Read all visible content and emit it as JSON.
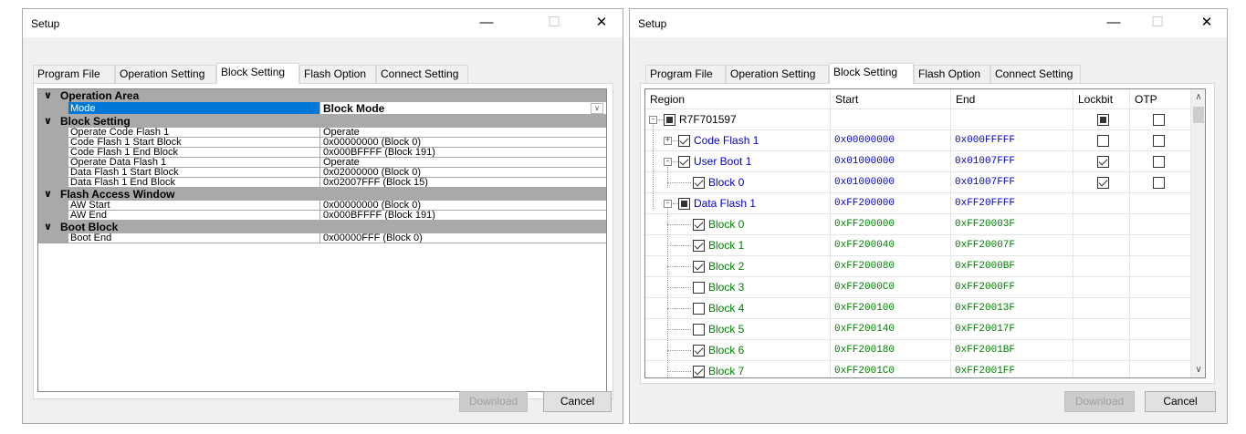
{
  "left_window": {
    "title": "Setup",
    "tabs": [
      "Program File",
      "Operation Setting",
      "Block Setting",
      "Flash Option",
      "Connect Setting"
    ],
    "active_tab": "Block Setting",
    "categories": {
      "operation_area": "Operation Area",
      "block_setting": "Block Setting",
      "flash_access_window": "Flash Access Window",
      "boot_block": "Boot Block"
    },
    "rows": {
      "mode": {
        "name": "Mode",
        "value": "Block Mode"
      },
      "operate_code_flash": {
        "name": "Operate Code Flash 1",
        "value": "Operate"
      },
      "code_flash_start": {
        "name": "Code Flash 1 Start Block",
        "value": "0x00000000 (Block 0)"
      },
      "code_flash_end": {
        "name": "Code Flash 1 End Block",
        "value": "0x000BFFFF (Block 191)"
      },
      "operate_data_flash": {
        "name": "Operate Data Flash 1",
        "value": "Operate"
      },
      "data_flash_start": {
        "name": "Data Flash 1 Start Block",
        "value": "0x02000000 (Block 0)"
      },
      "data_flash_end": {
        "name": "Data Flash 1 End Block",
        "value": "0x02007FFF (Block 15)"
      },
      "aw_start": {
        "name": "AW Start",
        "value": "0x00000000 (Block 0)"
      },
      "aw_end": {
        "name": "AW End",
        "value": "0x000BFFFF (Block 191)"
      },
      "boot_end": {
        "name": "Boot End",
        "value": "0x00000FFF (Block 0)"
      }
    },
    "buttons": {
      "download": "Download",
      "cancel": "Cancel"
    }
  },
  "right_window": {
    "title": "Setup",
    "tabs": [
      "Program File",
      "Operation Setting",
      "Block Setting",
      "Flash Option",
      "Connect Setting"
    ],
    "active_tab": "Block Setting",
    "columns": [
      "Region",
      "Start",
      "End",
      "Lockbit",
      "OTP"
    ],
    "rows": [
      {
        "label": "R7F701597",
        "start": "",
        "end": "",
        "check": "partial",
        "lockbit": "partial",
        "otp": "unchecked",
        "color": "black"
      },
      {
        "label": "Code Flash 1",
        "start": "0x00000000",
        "end": "0x000FFFFF",
        "check": "checked",
        "lockbit": "unchecked",
        "otp": "unchecked",
        "color": "blue"
      },
      {
        "label": "User Boot 1",
        "start": "0x01000000",
        "end": "0x01007FFF",
        "check": "checked",
        "lockbit": "checked",
        "otp": "unchecked",
        "color": "blue"
      },
      {
        "label": "Block 0",
        "start": "0x01000000",
        "end": "0x01007FFF",
        "check": "checked",
        "lockbit": "checked",
        "otp": "unchecked",
        "color": "blue"
      },
      {
        "label": "Data Flash 1",
        "start": "0xFF200000",
        "end": "0xFF20FFFF",
        "check": "partial",
        "lockbit": "",
        "otp": "",
        "color": "blue"
      },
      {
        "label": "Block 0",
        "start": "0xFF200000",
        "end": "0xFF20003F",
        "check": "checked",
        "color": "green"
      },
      {
        "label": "Block 1",
        "start": "0xFF200040",
        "end": "0xFF20007F",
        "check": "checked",
        "color": "green"
      },
      {
        "label": "Block 2",
        "start": "0xFF200080",
        "end": "0xFF2000BF",
        "check": "checked",
        "color": "green"
      },
      {
        "label": "Block 3",
        "start": "0xFF2000C0",
        "end": "0xFF2000FF",
        "check": "unchecked",
        "color": "green"
      },
      {
        "label": "Block 4",
        "start": "0xFF200100",
        "end": "0xFF20013F",
        "check": "unchecked",
        "color": "green"
      },
      {
        "label": "Block 5",
        "start": "0xFF200140",
        "end": "0xFF20017F",
        "check": "unchecked",
        "color": "green"
      },
      {
        "label": "Block 6",
        "start": "0xFF200180",
        "end": "0xFF2001BF",
        "check": "checked",
        "color": "green"
      },
      {
        "label": "Block 7",
        "start": "0xFF2001C0",
        "end": "0xFF2001FF",
        "check": "checked",
        "color": "green"
      }
    ],
    "buttons": {
      "download": "Download",
      "cancel": "Cancel"
    }
  },
  "colors": {
    "selection": "#0078d7",
    "category": "#a9a9a9",
    "blue_text": "#0000cc",
    "green_text": "#008000"
  }
}
